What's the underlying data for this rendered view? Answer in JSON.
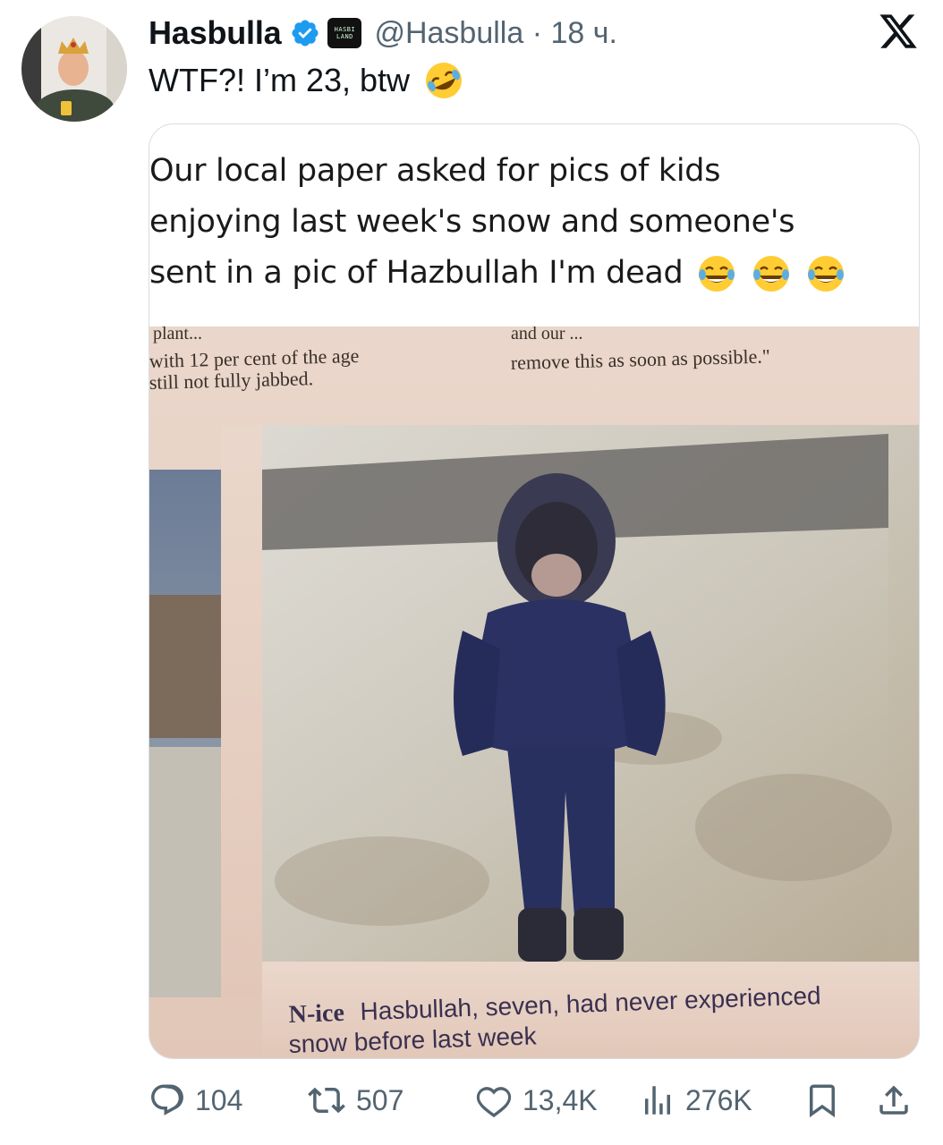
{
  "tweet": {
    "author": {
      "name": "Hasbulla",
      "handle": "@Hasbulla",
      "time": "18 ч.",
      "affiliate_badge": "HASBI LAND",
      "verified_color": "#1d9bf0"
    },
    "text": "WTF?! I’m 23, btw",
    "text_emoji": "rolling-on-floor-laughing-emoji",
    "platform_logo": "x-logo"
  },
  "quoted_post": {
    "lines": [
      "Our local paper asked for pics of kids",
      "enjoying last week's snow and someone's",
      "sent in a pic of Hazbullah I'm dead"
    ],
    "trailing_emoji": [
      "face-with-tears-of-joy-emoji",
      "face-with-tears-of-joy-emoji",
      "face-with-tears-of-joy-emoji"
    ],
    "newspaper": {
      "top_left_lines": [
        "plant...",
        "with 12 per cent of the age",
        "still not fully jabbed."
      ],
      "top_right_lines": [
        "and our ...",
        "remove this as soon as possible.\""
      ],
      "caption_bold": "N-ice",
      "caption_line1": "Hasbullah, seven, had never experienced",
      "caption_line2": "snow before last week"
    }
  },
  "actions": {
    "replies": "104",
    "reposts": "507",
    "likes": "13,4K",
    "views": "276K"
  },
  "colors": {
    "text": "#0f1419",
    "secondary": "#536471",
    "border": "#d7dde2",
    "accent": "#1d9bf0"
  }
}
